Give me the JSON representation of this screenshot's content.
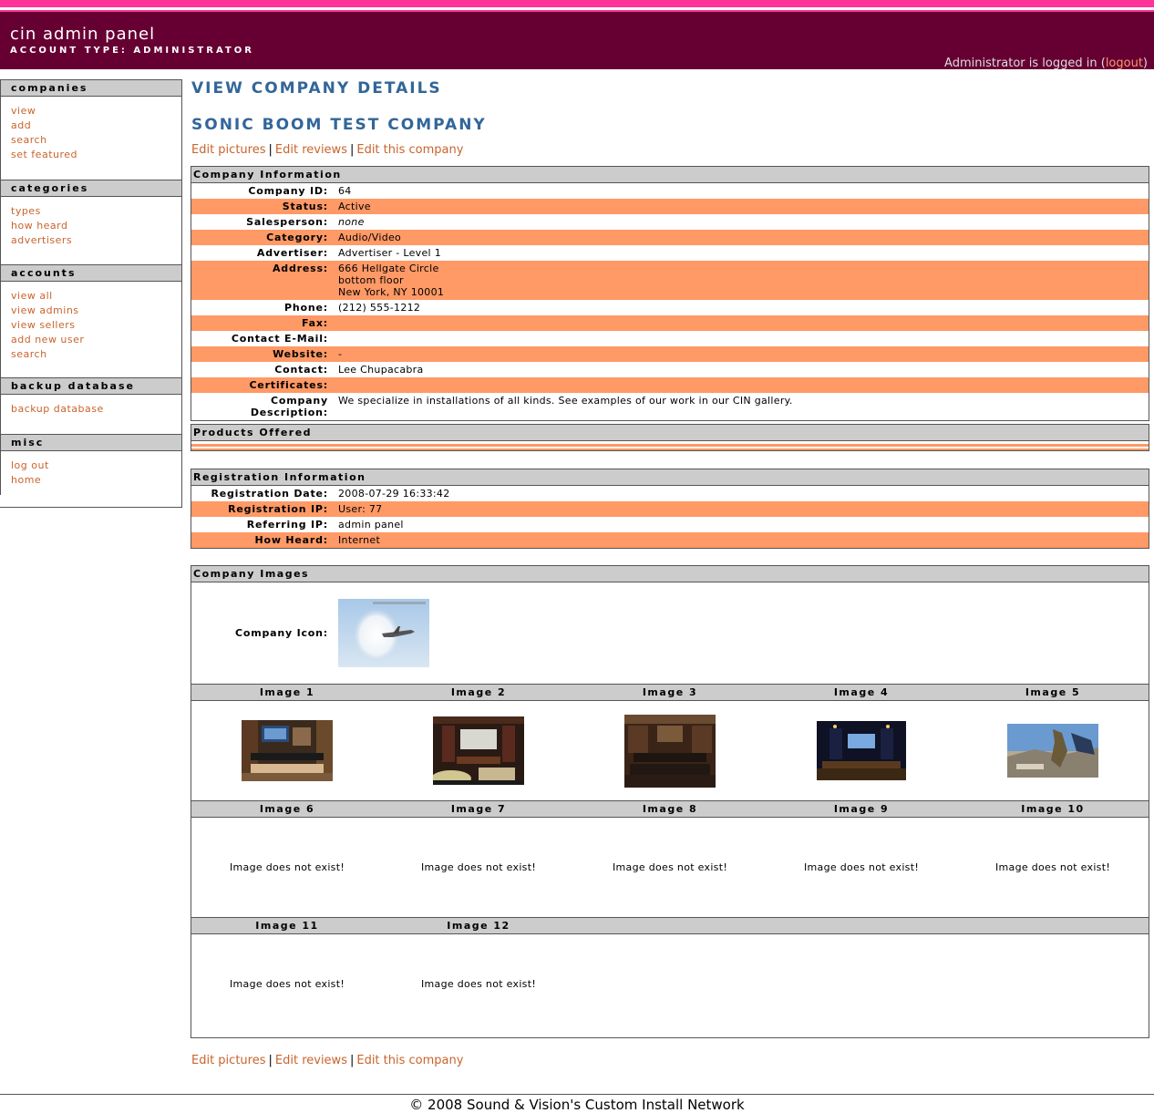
{
  "header": {
    "app_title": "cin admin panel",
    "account_type": "ACCOUNT TYPE: ADMINISTRATOR",
    "login_prefix": "Administrator is logged in (",
    "logout_label": "logout",
    "login_suffix": ")"
  },
  "sidebar": {
    "companies": {
      "title": "companies",
      "items": [
        "view",
        "add",
        "search",
        "set featured"
      ]
    },
    "categories": {
      "title": "categories",
      "items": [
        "types",
        "how heard",
        "advertisers"
      ]
    },
    "accounts": {
      "title": "accounts",
      "items": [
        "view all",
        "view admins",
        "view sellers",
        "add new user",
        "search"
      ]
    },
    "backup": {
      "title": "backup database",
      "items": [
        "backup database"
      ]
    },
    "misc": {
      "title": "misc",
      "items": [
        "log out",
        "home"
      ]
    }
  },
  "main": {
    "page_title": "VIEW COMPANY DETAILS",
    "company_name": "SONIC BOOM TEST COMPANY",
    "links": {
      "edit_pictures": "Edit pictures",
      "edit_reviews": "Edit reviews",
      "edit_company": "Edit this company",
      "sep": "|"
    },
    "company_info": {
      "title": "Company Information",
      "fields": {
        "id_label": "Company ID:",
        "id": "64",
        "status_label": "Status:",
        "status": "Active",
        "salesperson_label": "Salesperson:",
        "salesperson": "none",
        "category_label": "Category:",
        "category": "Audio/Video",
        "advertiser_label": "Advertiser:",
        "advertiser": "Advertiser - Level 1",
        "address_label": "Address:",
        "address_1": "666 Hellgate Circle",
        "address_2": "bottom floor",
        "address_3": "New York, NY  10001",
        "phone_label": "Phone:",
        "phone": "(212) 555-1212",
        "fax_label": "Fax:",
        "fax": "",
        "email_label": "Contact E-Mail:",
        "email": "",
        "website_label": "Website:",
        "website": "-",
        "contact_label": "Contact:",
        "contact": "Lee Chupacabra",
        "certificates_label": "Certificates:",
        "certificates": "",
        "description_label": "Company Description:",
        "description": "We specialize in installations of all kinds. See examples of our work in our CIN gallery."
      }
    },
    "products": {
      "title": "Products Offered"
    },
    "registration": {
      "title": "Registration Information",
      "date_label": "Registration Date:",
      "date": "2008-07-29 16:33:42",
      "ip_label": "Registration IP:",
      "ip": "User: 77",
      "ref_label": "Referring IP:",
      "ref": "admin panel",
      "heard_label": "How Heard:",
      "heard": "Internet"
    },
    "images": {
      "title": "Company Images",
      "icon_label": "Company Icon:",
      "row1": [
        "Image 1",
        "Image 2",
        "Image 3",
        "Image 4",
        "Image 5"
      ],
      "row2": [
        "Image 6",
        "Image 7",
        "Image 8",
        "Image 9",
        "Image 10"
      ],
      "row3": [
        "Image 11",
        "Image 12"
      ],
      "missing": "Image does not exist!"
    }
  },
  "footer": {
    "text": "© 2008 Sound & Vision's Custom Install Network"
  }
}
